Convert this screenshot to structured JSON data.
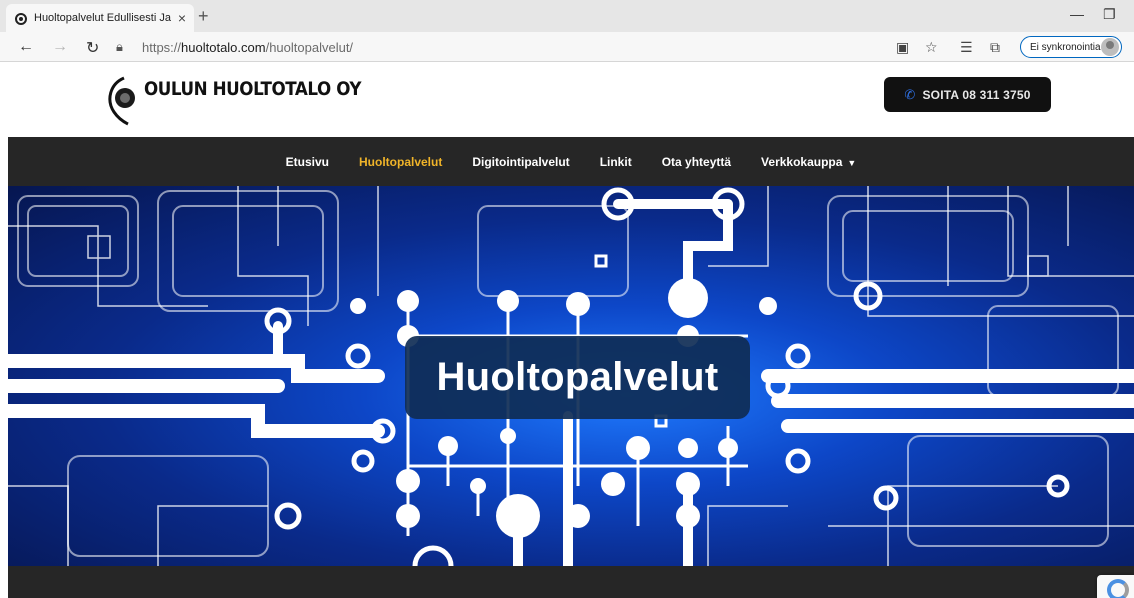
{
  "browser": {
    "tab_title": "Huoltopalvelut Edullisesti Ja Amm",
    "url_prefix": "https://",
    "url_host": "huoltotalo.com",
    "url_path": "/huoltopalvelut/",
    "sync_label": "Ei synkronointia"
  },
  "header": {
    "logo_text": "OULUN HUOLTOTALO OY",
    "call_label": "SOITA 08 311 3750"
  },
  "nav": {
    "items": [
      {
        "label": "Etusivu",
        "active": false
      },
      {
        "label": "Huoltopalvelut",
        "active": true
      },
      {
        "label": "Digitointipalvelut",
        "active": false
      },
      {
        "label": "Linkit",
        "active": false
      },
      {
        "label": "Ota yhteyttä",
        "active": false
      },
      {
        "label": "Verkkokauppa",
        "active": false,
        "has_dropdown": true
      }
    ]
  },
  "hero": {
    "title": "Huoltopalvelut"
  },
  "colors": {
    "nav_bg": "#262626",
    "nav_active": "#f0b429",
    "call_bg": "#111111",
    "phone_icon": "#2f6fe0",
    "hero_blue": "#0d47c8"
  }
}
